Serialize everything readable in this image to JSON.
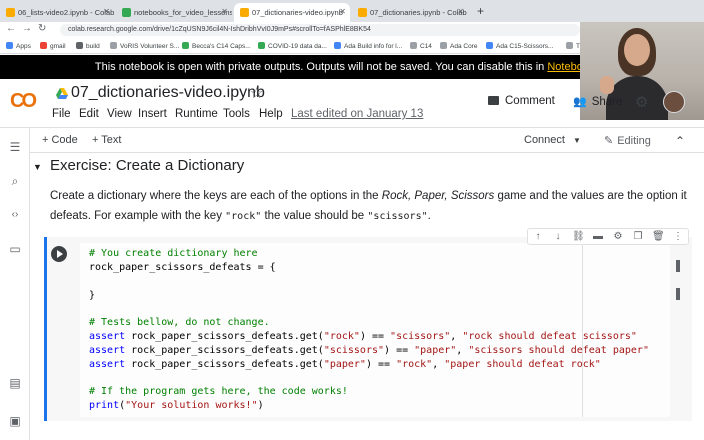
{
  "browser": {
    "tabs": [
      {
        "label": "06_lists-video2.ipynb - Colab"
      },
      {
        "label": "notebooks_for_video_lessons"
      },
      {
        "label": "07_dictionaries-video.ipynb"
      },
      {
        "label": "07_dictionaries.ipynb - Colab"
      }
    ],
    "new_tab": "+",
    "url": "colab.research.google.com/drive/1cZqUSN9J6cil4N-IshDribhVvI0J9mPs#scrollTo=fASPhlE8BK54",
    "bookmarks": [
      "Apps",
      "gmail",
      "build",
      "VoRIS Volunteer S...",
      "Becca's C14 Caps...",
      "COVID-19 data da...",
      "Ada Build info for l...",
      "C14",
      "Ada Core",
      "Ada C15-Scissors...",
      "Th"
    ]
  },
  "banner": {
    "text": "This notebook is open with private outputs. Outputs will not be saved. You can disable this in ",
    "link": "Notebook se"
  },
  "header": {
    "logo": "CO",
    "title": "07_dictionaries-video.ipynb",
    "menu": [
      "File",
      "Edit",
      "View",
      "Insert",
      "Runtime",
      "Tools",
      "Help"
    ],
    "last_edited": "Last edited on January 13",
    "comment": "Comment",
    "share": "Share"
  },
  "toolbar": {
    "add_code": "+ Code",
    "add_text": "+ Text",
    "connect": "Connect",
    "editing": "Editing"
  },
  "section": {
    "heading": "Exercise: Create a Dictionary",
    "para_prefix": "Create a dictionary where the keys are each of the options in the ",
    "para_italic": "Rock, Paper, Scissors",
    "para_mid": " game and the values are the option it defeats. For example with the key ",
    "key_example": "\"rock\"",
    "para_mid2": " the value should be ",
    "value_example": "\"scissors\"",
    "para_end": "."
  },
  "code": {
    "l1": "# You create dictionary here",
    "l2": "rock_paper_scissors_defeats = {",
    "l4": "}",
    "l6": "# Tests bellow, do not change.",
    "kw": "assert",
    "a1_pre": " rock_paper_scissors_defeats.get(",
    "a1_key": "\"rock\"",
    "a1_mid": ") == ",
    "a1_val": "\"scissors\"",
    "a1_comma": ", ",
    "a1_msg": "\"rock should defeat scissors\"",
    "a2_key": "\"scissors\"",
    "a2_val": "\"paper\"",
    "a2_msg": "\"scissors should defeat paper\"",
    "a3_key": "\"paper\"",
    "a3_val": "\"rock\"",
    "a3_msg": "\"paper should defeat rock\"",
    "l11": "# If the program gets here, the code works!",
    "print_kw": "print",
    "print_open": "(",
    "print_str": "\"Your solution works!\"",
    "print_close": ")"
  },
  "colors": {
    "accent": "#1a73e8",
    "banner_link": "#fbbc04",
    "logo_orange": "#f9ab00"
  }
}
